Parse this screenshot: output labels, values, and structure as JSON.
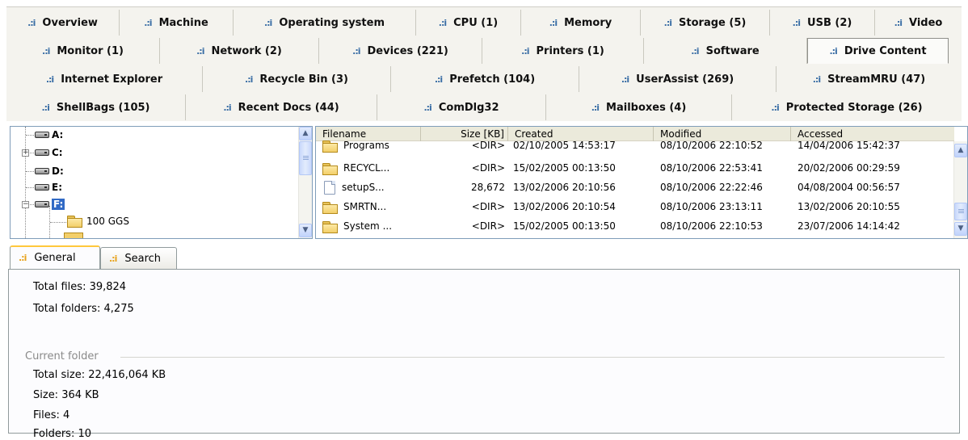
{
  "tabs": {
    "row0": [
      "Overview",
      "Machine",
      "Operating system",
      "CPU (1)",
      "Memory",
      "Storage (5)",
      "USB (2)",
      "Video"
    ],
    "row1": [
      "Monitor (1)",
      "Network (2)",
      "Devices (221)",
      "Printers (1)",
      "Software",
      "Drive Content"
    ],
    "row2": [
      "Internet Explorer",
      "Recycle Bin (3)",
      "Prefetch (104)",
      "UserAssist (269)",
      "StreamMRU (47)"
    ],
    "row3": [
      "ShellBags (105)",
      "Recent Docs (44)",
      "ComDlg32",
      "Mailboxes (4)",
      "Protected Storage (26)"
    ],
    "active": "Drive Content",
    "icon": "bar-chart-icon"
  },
  "tree": {
    "items": [
      {
        "label": "A:",
        "icon": "drive-icon"
      },
      {
        "label": "C:",
        "icon": "drive-icon",
        "expander": "+"
      },
      {
        "label": "D:",
        "icon": "drive-icon"
      },
      {
        "label": "E:",
        "icon": "drive-icon"
      },
      {
        "label": "F:",
        "icon": "drive-icon",
        "expander": "−",
        "selected": true
      },
      {
        "label": "100 GGS",
        "icon": "folder-icon"
      }
    ]
  },
  "filelist": {
    "columns": [
      "Filename",
      "Size [KB]",
      "Created",
      "Modified",
      "Accessed"
    ],
    "rows": [
      {
        "name": "Programs",
        "icon": "folder-icon",
        "size": "<DIR>",
        "created": "02/10/2005 14:53:17",
        "modified": "08/10/2006 22:10:52",
        "accessed": "14/04/2006 15:42:37"
      },
      {
        "name": "RECYCL...",
        "icon": "folder-icon",
        "size": "<DIR>",
        "created": "15/02/2005 00:13:50",
        "modified": "08/10/2006 22:53:41",
        "accessed": "20/02/2006 00:29:59"
      },
      {
        "name": "setupS...",
        "icon": "file-icon",
        "size": "28,672",
        "created": "13/02/2006 20:10:56",
        "modified": "08/10/2006 22:22:46",
        "accessed": "04/08/2004 00:56:57"
      },
      {
        "name": "SMRTN...",
        "icon": "folder-icon",
        "size": "<DIR>",
        "created": "13/02/2006 20:10:54",
        "modified": "08/10/2006 23:13:11",
        "accessed": "13/02/2006 20:10:55"
      },
      {
        "name": "System ...",
        "icon": "folder-icon",
        "size": "<DIR>",
        "created": "15/02/2005 00:13:50",
        "modified": "08/10/2006 22:10:53",
        "accessed": "23/07/2006 14:14:42"
      }
    ]
  },
  "bottom_tabs": [
    "General",
    "Search"
  ],
  "bottom_active": "General",
  "general": {
    "total_files": "Total files: 39,824",
    "total_folders": "Total folders: 4,275",
    "current_folder_label": "Current folder",
    "total_size": "Total size: 22,416,064 KB",
    "size": "Size: 364 KB",
    "files": "Files: 4",
    "folders": "Folders: 10"
  },
  "colors": {
    "tab_icon": "#3a6ea5",
    "selection": "#316ac5",
    "active_tab_accent": "#ffc83c"
  }
}
